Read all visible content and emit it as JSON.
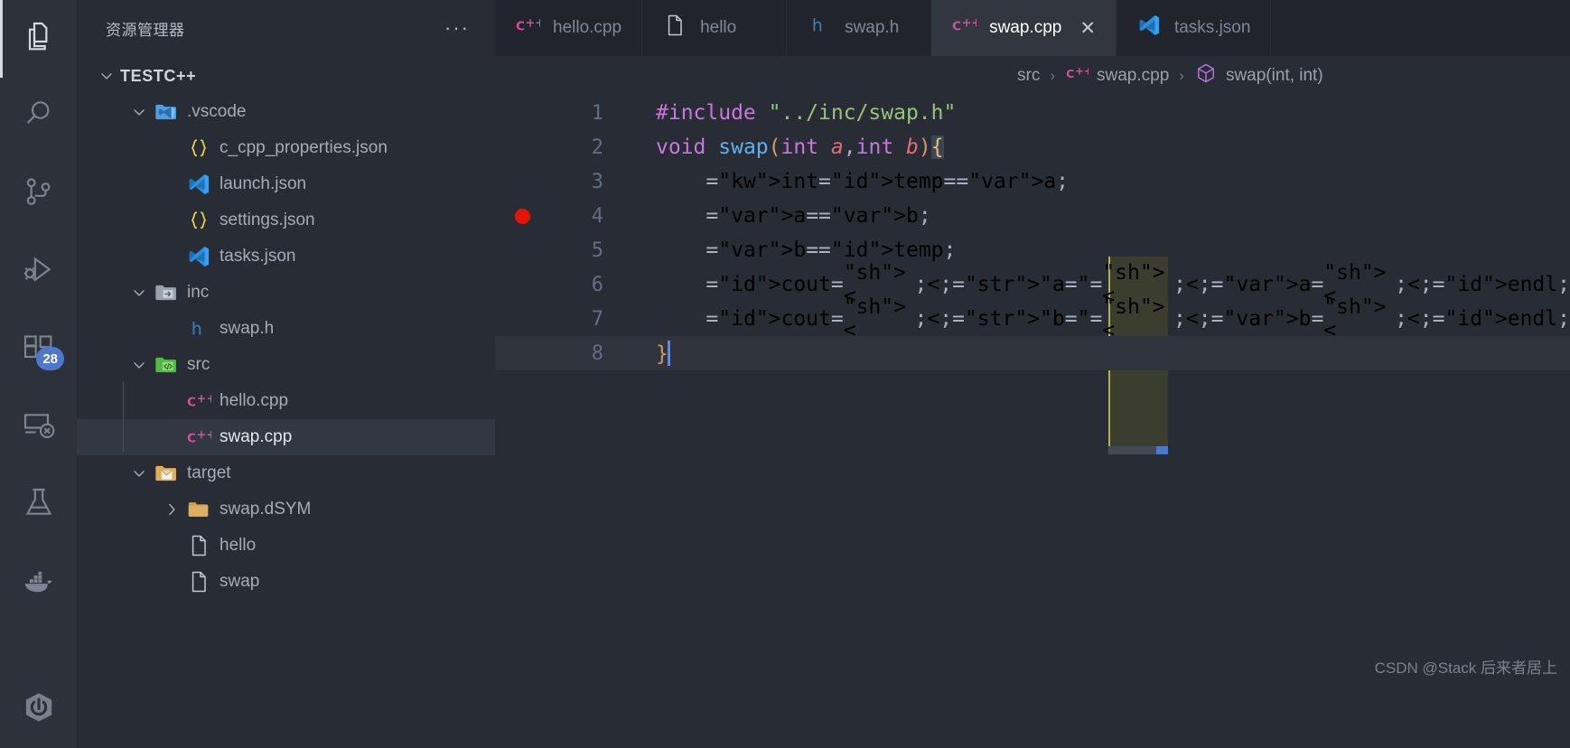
{
  "activity_bar": {
    "items": [
      {
        "name": "explorer",
        "icon": "files-icon",
        "active": true,
        "badge": null
      },
      {
        "name": "search",
        "icon": "search-icon",
        "active": false,
        "badge": null
      },
      {
        "name": "source-control",
        "icon": "source-control-icon",
        "active": false,
        "badge": null
      },
      {
        "name": "run-and-debug",
        "icon": "run-debug-icon",
        "active": false,
        "badge": null
      },
      {
        "name": "extensions",
        "icon": "extensions-icon",
        "active": false,
        "badge": "28"
      },
      {
        "name": "remote-explorer",
        "icon": "remote-explorer-icon",
        "active": false,
        "badge": null
      },
      {
        "name": "testing",
        "icon": "beaker-icon",
        "active": false,
        "badge": null
      },
      {
        "name": "docker",
        "icon": "docker-whale-icon",
        "active": false,
        "badge": null
      }
    ],
    "bottom_items": [
      {
        "name": "remote-power",
        "icon": "power-icon"
      }
    ]
  },
  "sidebar": {
    "title": "资源管理器",
    "more_actions": "···",
    "tree": [
      {
        "label": "TESTC++",
        "depth": 0,
        "twisty": "chevron-down-icon",
        "icon": "none",
        "selected": false,
        "root": true
      },
      {
        "label": ".vscode",
        "depth": 1,
        "twisty": "chevron-down-icon",
        "icon": "folder-vscode-icon",
        "selected": false
      },
      {
        "label": "c_cpp_properties.json",
        "depth": 2,
        "twisty": "none",
        "icon": "json-icon",
        "selected": false
      },
      {
        "label": "launch.json",
        "depth": 2,
        "twisty": "none",
        "icon": "vscode-icon",
        "selected": false
      },
      {
        "label": "settings.json",
        "depth": 2,
        "twisty": "none",
        "icon": "json-icon",
        "selected": false
      },
      {
        "label": "tasks.json",
        "depth": 2,
        "twisty": "none",
        "icon": "vscode-icon",
        "selected": false
      },
      {
        "label": "inc",
        "depth": 1,
        "twisty": "chevron-down-icon",
        "icon": "folder-include-icon",
        "selected": false
      },
      {
        "label": "swap.h",
        "depth": 2,
        "twisty": "none",
        "icon": "h-icon",
        "selected": false
      },
      {
        "label": "src",
        "depth": 1,
        "twisty": "chevron-down-icon",
        "icon": "folder-src-icon",
        "selected": false
      },
      {
        "label": "hello.cpp",
        "depth": 2,
        "twisty": "none",
        "icon": "cpp-icon",
        "selected": false
      },
      {
        "label": "swap.cpp",
        "depth": 2,
        "twisty": "none",
        "icon": "cpp-icon",
        "selected": true
      },
      {
        "label": "target",
        "depth": 1,
        "twisty": "chevron-down-icon",
        "icon": "folder-target-icon",
        "selected": false
      },
      {
        "label": "swap.dSYM",
        "depth": 2,
        "twisty": "chevron-right-icon",
        "icon": "folder-icon",
        "selected": false
      },
      {
        "label": "hello",
        "depth": 2,
        "twisty": "none",
        "icon": "file-icon",
        "selected": false
      },
      {
        "label": "swap",
        "depth": 2,
        "twisty": "none",
        "icon": "file-icon",
        "selected": false
      }
    ]
  },
  "tabs": [
    {
      "label": "hello.cpp",
      "icon": "cpp-icon",
      "active": false,
      "close": ""
    },
    {
      "label": "hello",
      "icon": "file-icon",
      "active": false,
      "close": ""
    },
    {
      "label": "swap.h",
      "icon": "h-icon",
      "active": false,
      "close": ""
    },
    {
      "label": "swap.cpp",
      "icon": "cpp-icon",
      "active": true,
      "close": "✕"
    },
    {
      "label": "tasks.json",
      "icon": "vscode-icon",
      "active": false,
      "close": ""
    }
  ],
  "breadcrumb": [
    {
      "label": "src",
      "icon": "none"
    },
    {
      "label": "swap.cpp",
      "icon": "cpp-icon"
    },
    {
      "label": "swap(int, int)",
      "icon": "symbol-method-icon"
    }
  ],
  "breadcrumb_separator": "›",
  "editor": {
    "file": "swap.cpp",
    "language": "C++",
    "breakpoint_line": 4,
    "cursor_line": 8,
    "lines": [
      {
        "n": "1",
        "breakpoint": false,
        "text": "#include \"../inc/swap.h\""
      },
      {
        "n": "2",
        "breakpoint": false,
        "text": "void swap(int a,int b){"
      },
      {
        "n": "3",
        "breakpoint": false,
        "text": "    int temp = a;"
      },
      {
        "n": "4",
        "breakpoint": true,
        "text": "    a = b;"
      },
      {
        "n": "5",
        "breakpoint": false,
        "text": "    b = temp;"
      },
      {
        "n": "6",
        "breakpoint": false,
        "text": "    cout << \"a = \" << a << endl;"
      },
      {
        "n": "7",
        "breakpoint": false,
        "text": "    cout << \"b = \" << b << endl;"
      },
      {
        "n": "8",
        "breakpoint": false,
        "text": "}"
      }
    ]
  },
  "watermark": "CSDN @Stack 后来者居上",
  "colors": {
    "background": "#282c34",
    "sidebar_bg": "#282c34",
    "activitybar_bg": "#2c313a",
    "tabbar_bg": "#21252b",
    "active_tab_bg": "#32373f",
    "accent": "#528bff",
    "badge": "#4d78cc",
    "breakpoint": "#e51400",
    "keyword": "#c678dd",
    "function": "#61afef",
    "string": "#98c379",
    "variable": "#e06c75",
    "comment": "#5c6370",
    "indent_guide_active": "#b5b14a"
  }
}
